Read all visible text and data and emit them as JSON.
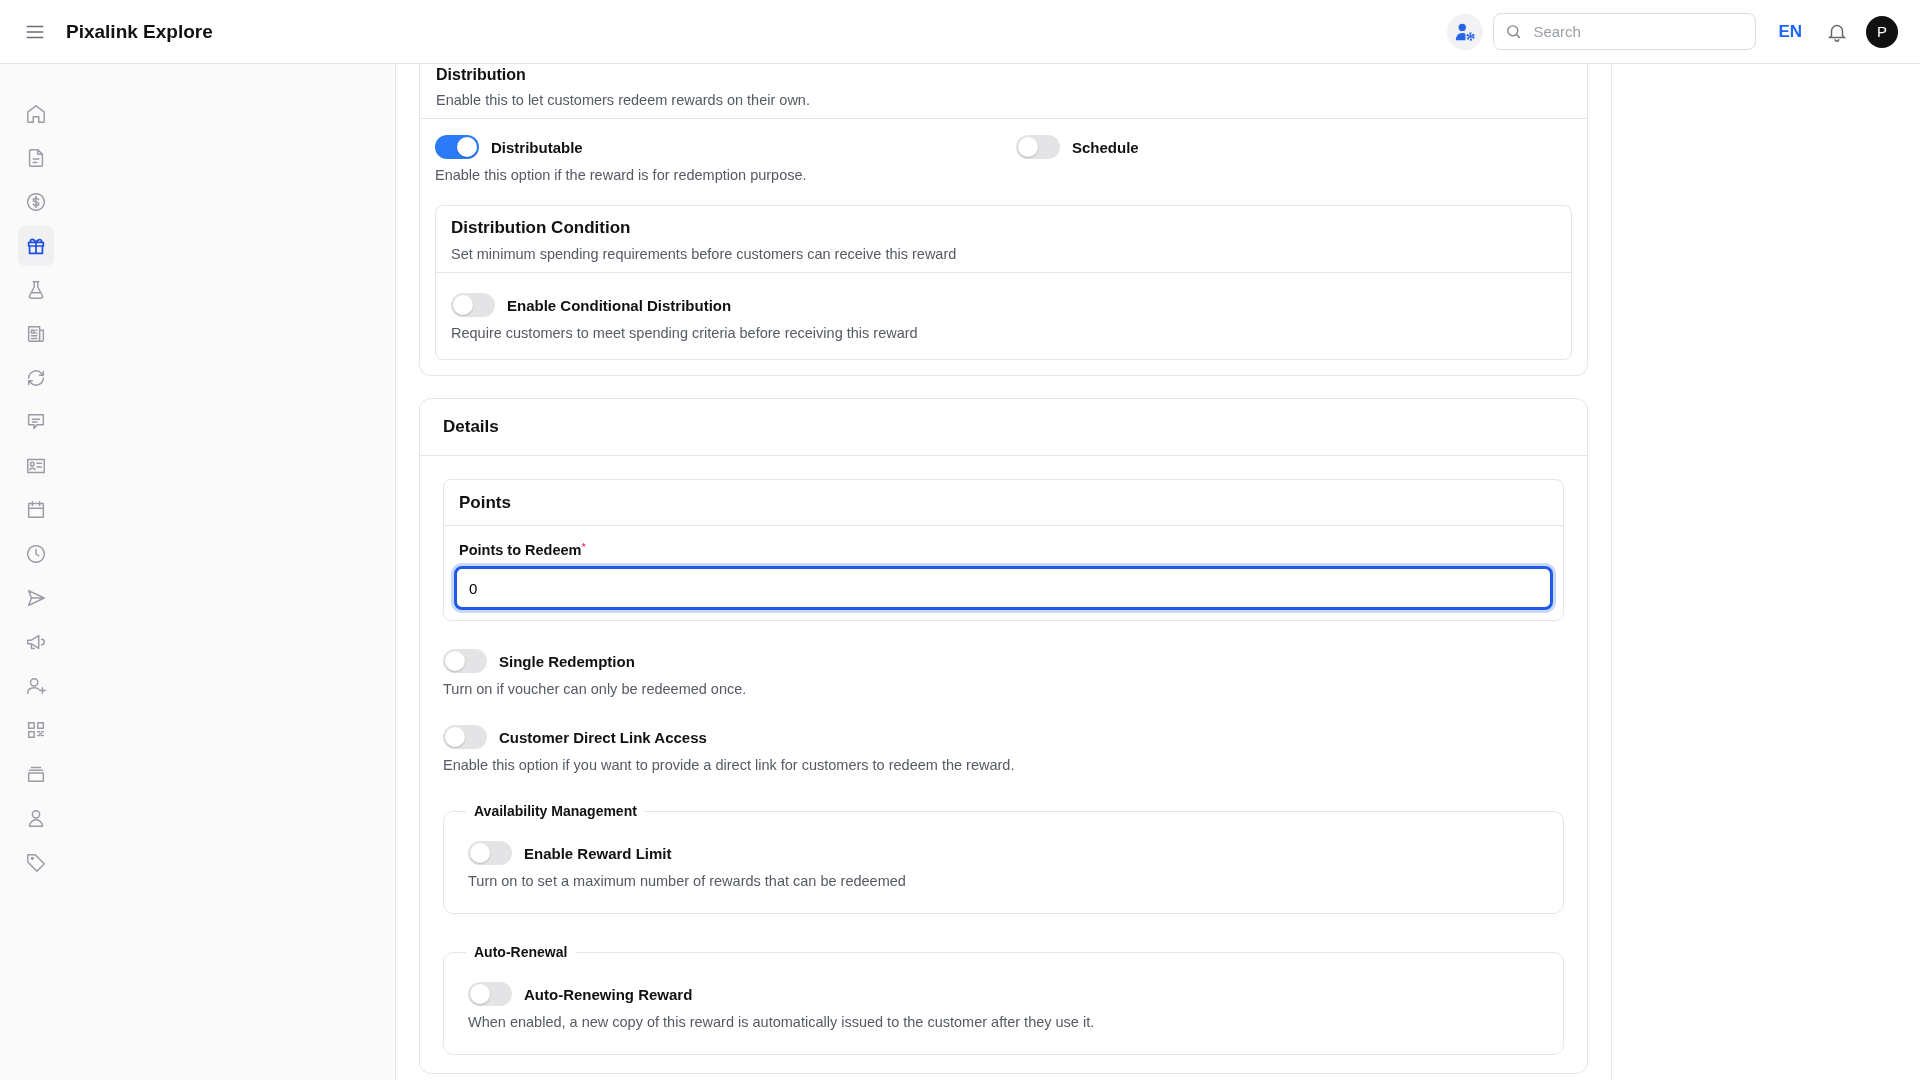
{
  "header": {
    "title": "Pixalink Explore",
    "search": {
      "placeholder": "Search"
    },
    "language": "EN",
    "avatar": "P"
  },
  "sidebar": {
    "items": [
      {
        "selected": false
      },
      {
        "selected": false
      },
      {
        "selected": false
      },
      {
        "selected": true
      },
      {
        "selected": false
      },
      {
        "selected": false
      },
      {
        "selected": false
      },
      {
        "selected": false
      },
      {
        "selected": false
      },
      {
        "selected": false
      },
      {
        "selected": false
      },
      {
        "selected": false
      },
      {
        "selected": false
      },
      {
        "selected": false
      },
      {
        "selected": false
      },
      {
        "selected": false
      },
      {
        "selected": false
      },
      {
        "selected": false
      }
    ]
  },
  "distribution": {
    "title": "Distribution",
    "description": "Enable this to let customers redeem rewards on their own.",
    "toggles": [
      {
        "label": "Distributable",
        "on": true,
        "hint": "Enable this option if the reward is for redemption purpose."
      },
      {
        "label": "Schedule",
        "on": false
      }
    ],
    "condition": {
      "title": "Distribution Condition",
      "description": "Set minimum spending requirements before customers can receive this reward",
      "toggle": {
        "label": "Enable Conditional Distribution",
        "on": false,
        "hint": "Require customers to meet spending criteria before receiving this reward"
      }
    }
  },
  "details": {
    "title": "Details",
    "points": {
      "title": "Points",
      "field": {
        "label": "Points to Redeem",
        "required_mark": "*",
        "value": "0",
        "focused": true
      }
    },
    "toggles": [
      {
        "label": "Single Redemption",
        "on": false,
        "hint": "Turn on if voucher can only be redeemed once."
      },
      {
        "label": "Customer Direct Link Access",
        "on": false,
        "hint": "Enable this option if you want to provide a direct link for customers to redeem the reward."
      }
    ],
    "groups": [
      {
        "legend": "Availability Management",
        "toggle": {
          "label": "Enable Reward Limit",
          "on": false,
          "hint": "Turn on to set a maximum number of rewards that can be redeemed"
        }
      },
      {
        "legend": "Auto-Renewal",
        "toggle": {
          "label": "Auto-Renewing Reward",
          "on": false,
          "hint": "When enabled, a new copy of this reward is automatically issued to the customer after they use it."
        }
      }
    ]
  }
}
